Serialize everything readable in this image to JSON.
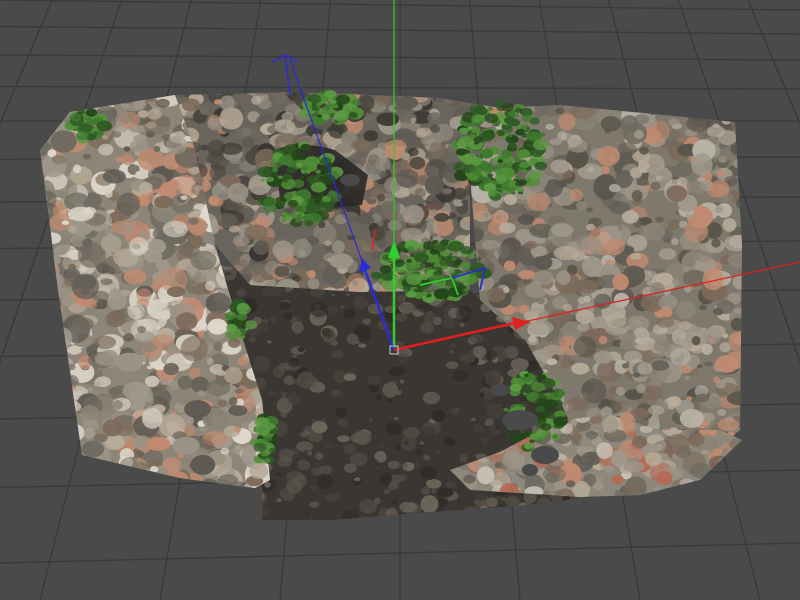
{
  "viewport": {
    "background": "#4a4a4a",
    "grid_color": "#3a3a3a",
    "horizon_color": "#3d3d3d"
  },
  "axes": {
    "x_color": "#e02020",
    "y_color": "#2fcf2f",
    "z_color": "#2b2bd8"
  },
  "model": {
    "kind": "point-cloud-scan",
    "subject": "ruined-stone-enclosure",
    "stone_colors": [
      "#8a8478",
      "#a09a8c",
      "#6f6a60",
      "#b7aa98",
      "#7c6a5a",
      "#c08a70",
      "#9c9488",
      "#5e5a52"
    ],
    "soil_colors": [
      "#3a3632",
      "#2f2c28",
      "#45403a",
      "#4f4a42"
    ],
    "foliage_colors": [
      "#2f5a24",
      "#3f7a2e",
      "#4f8d35",
      "#244619",
      "#5b9a42"
    ]
  }
}
